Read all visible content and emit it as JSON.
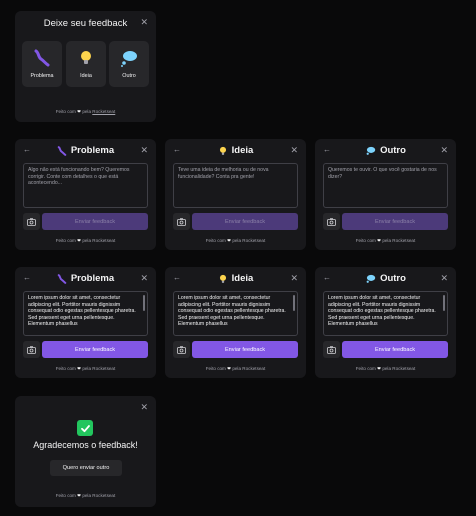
{
  "select": {
    "title": "Deixe seu feedback",
    "types": [
      {
        "label": "Problema",
        "icon": "bug-icon"
      },
      {
        "label": "Ideia",
        "icon": "lightbulb-icon"
      },
      {
        "label": "Outro",
        "icon": "thought-balloon-icon"
      }
    ]
  },
  "footer": {
    "prefix": "Feito com",
    "suffix": "pela",
    "brand": "Rocketseat"
  },
  "forms": {
    "problem": {
      "title": "Problema",
      "placeholder": "Algo não está funcionando bem? Queremos corrigir. Conte com detalhes o que está acontecendo..."
    },
    "idea": {
      "title": "Ideia",
      "placeholder": "Teve uma ideia de melhoria ou de nova funcionalidade? Conta pra gente!"
    },
    "other": {
      "title": "Outro",
      "placeholder": "Queremos te ouvir. O que você gostaria de nos dizer?"
    }
  },
  "filled_text": "Lorem ipsum dolor sit amet, consectetur adipiscing elit. Porttitor mauris dignissim consequat odio egestas pellentesque pharetra. Sed praesent eget urna pellentesque. Elementum phasellus",
  "send_label": "Enviar feedback",
  "success": {
    "title": "Agradecemos o feedback!",
    "again_label": "Quero enviar outro"
  },
  "colors": {
    "brand": "#8257e5",
    "card": "#18181b",
    "background": "#09090a"
  }
}
